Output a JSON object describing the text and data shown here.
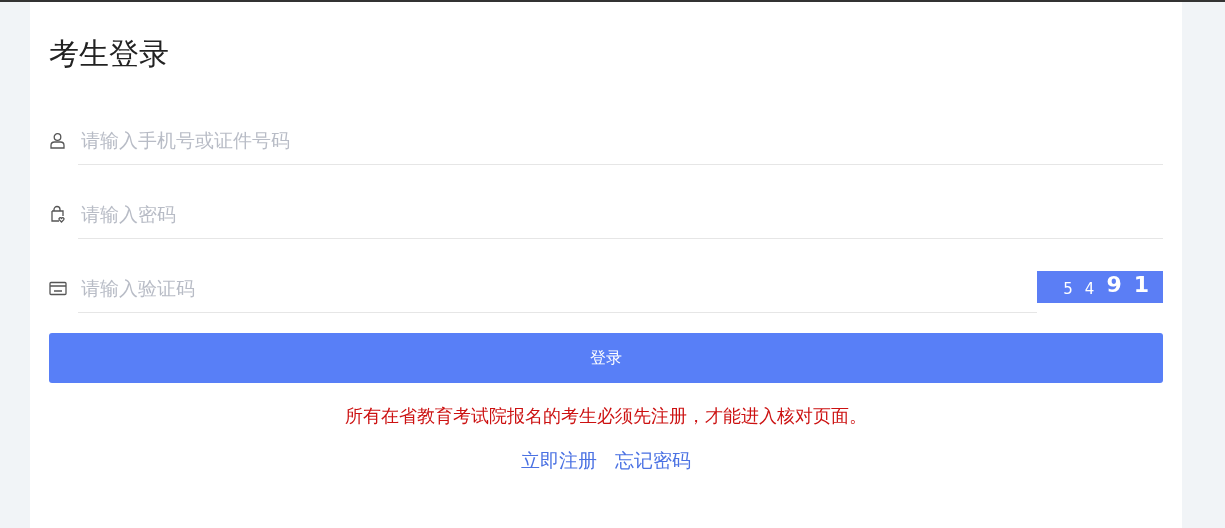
{
  "title": "考生登录",
  "fields": [
    {
      "placeholder": "请输入手机号或证件号码"
    },
    {
      "placeholder": "请输入密码"
    },
    {
      "placeholder": "请输入验证码"
    }
  ],
  "captcha": [
    "5",
    "4",
    "9",
    "1"
  ],
  "login_button": "登录",
  "notice": "所有在省教育考试院报名的考生必须先注册，才能进入核对页面。",
  "links": [
    "立即注册",
    "忘记密码"
  ]
}
